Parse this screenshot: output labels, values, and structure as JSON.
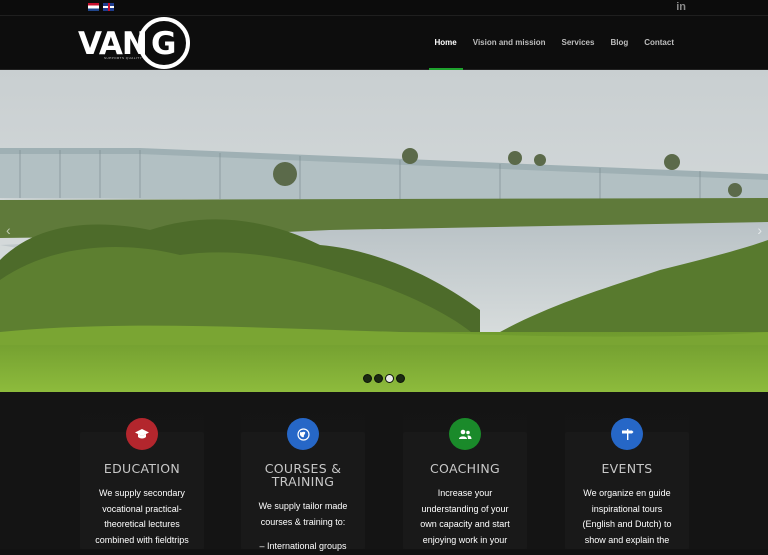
{
  "topbar": {
    "languages": [
      {
        "name": "nl-flag-icon"
      },
      {
        "name": "uk-flag-icon"
      }
    ],
    "social": "in"
  },
  "header": {
    "logo_text": "VAN",
    "logo_letter": "G",
    "logo_tagline": "SUPPORTS QUALITY"
  },
  "nav": {
    "items": [
      {
        "label": "Home",
        "active": true
      },
      {
        "label": "Vision and mission"
      },
      {
        "label": "Services"
      },
      {
        "label": "Blog"
      },
      {
        "label": "Contact"
      }
    ],
    "accent": "#1fa22e"
  },
  "slider": {
    "slides": 4,
    "active_slide": 3,
    "prev_label": "‹",
    "next_label": "›"
  },
  "services": [
    {
      "icon": "graduation-cap-icon",
      "icon_color": "#b3262d",
      "icon_glyph": "🎓",
      "title": "EDUCATION",
      "text": [
        "We supply secondary",
        "vocational practical-",
        "theoretical lectures",
        "combined with fieldtrips"
      ]
    },
    {
      "icon": "globe-icon",
      "icon_color": "#2667c7",
      "icon_glyph": "◍",
      "title": "COURSES & TRAINING",
      "text": [
        "We supply tailor made",
        "courses & training to:",
        "",
        "– International groups"
      ]
    },
    {
      "icon": "users-icon",
      "icon_color": "#1a8a2a",
      "icon_glyph": "👥",
      "title": "COACHING",
      "text": [
        "Increase your",
        "understanding of your",
        "own capacity and start",
        "enjoying work in your"
      ]
    },
    {
      "icon": "signpost-icon",
      "icon_color": "#2667c7",
      "icon_glyph": "⚑",
      "title": "EVENTS",
      "text": [
        "We organize en guide",
        "inspirational tours",
        "(English and Dutch) to",
        "show and explain the"
      ]
    }
  ]
}
